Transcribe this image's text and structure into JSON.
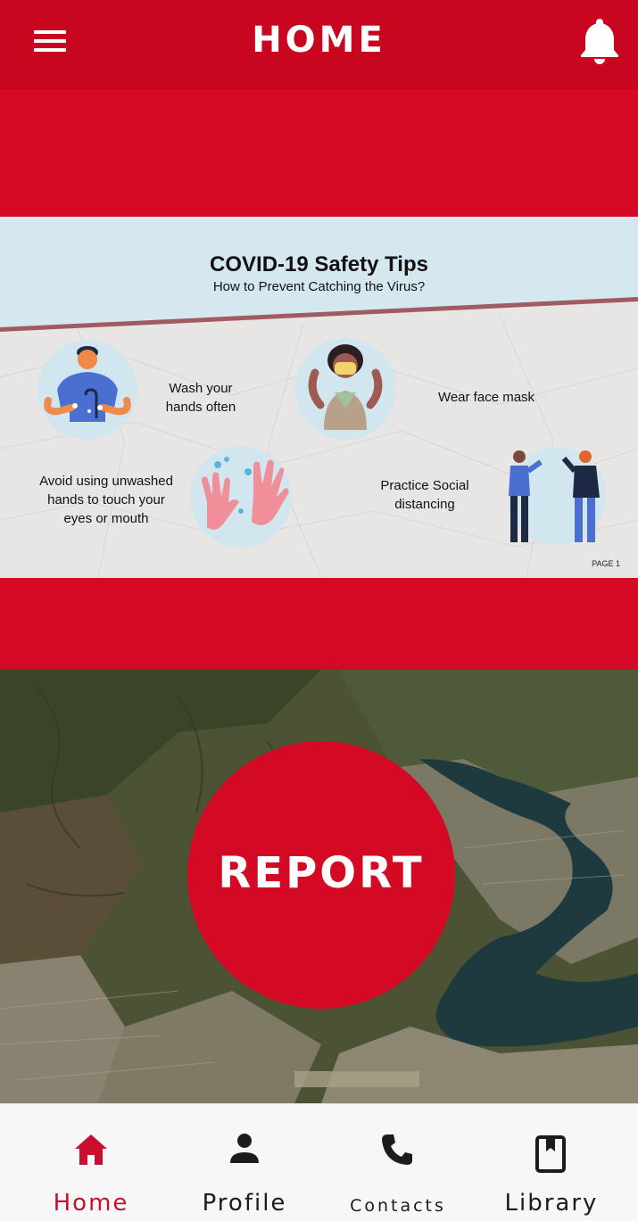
{
  "header": {
    "title": "HOME",
    "menu_icon": "hamburger-menu-icon",
    "notification_icon": "bell-icon"
  },
  "banner": {
    "title": "COVID-19 Safety Tips",
    "subtitle": "How to Prevent Catching the Virus?",
    "tips": [
      {
        "label": "Wash your\nhands often",
        "illustration": "handwashing-illustration"
      },
      {
        "label": "Wear face mask",
        "illustration": "face-mask-illustration"
      },
      {
        "label": "Avoid using unwashed\nhands to touch your\neyes or mouth",
        "illustration": "gloves-illustration"
      },
      {
        "label": "Practice Social\ndistancing",
        "illustration": "social-distancing-illustration"
      }
    ],
    "page_label": "PAGE 1"
  },
  "report": {
    "label": "REPORT"
  },
  "bottom_nav": {
    "items": [
      {
        "label": "Home",
        "icon": "home-icon",
        "active": true
      },
      {
        "label": "Profile",
        "icon": "person-icon",
        "active": false
      },
      {
        "label": "Contacts",
        "icon": "phone-icon",
        "active": false
      },
      {
        "label": "Library",
        "icon": "book-icon",
        "active": false
      }
    ]
  },
  "colors": {
    "brand_red": "#d40a24",
    "header_red": "#c90620",
    "active_nav": "#c8102e",
    "nav_text": "#1c1c1c"
  }
}
